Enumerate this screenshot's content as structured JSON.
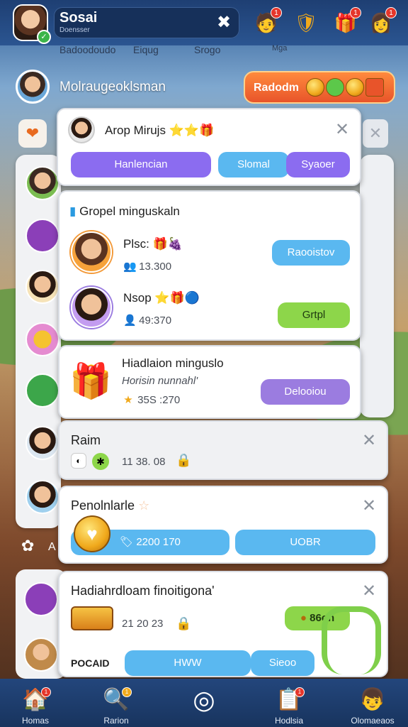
{
  "header": {
    "title": "Sosai",
    "subtitle": "Doensser",
    "close_glyph": "✖",
    "icons": [
      {
        "name": "friend-request-icon",
        "glyph": "🧑",
        "badge": "1"
      },
      {
        "name": "shield-icon",
        "glyph": "🛡",
        "badge": ""
      },
      {
        "name": "gift-icon",
        "glyph": "🎁",
        "badge": "1"
      },
      {
        "name": "profile-notification-icon",
        "glyph": "👩",
        "badge": "1"
      }
    ]
  },
  "subbar": {
    "items": [
      "Badoodoudo",
      "Eiqug",
      "Srogo",
      "Mga"
    ]
  },
  "background": {
    "user_name": "Molraugeoklsman",
    "orange_button_label": "Radodm"
  },
  "cards": {
    "group_invite": {
      "title": "Arop Mirujs",
      "stars": "⭐⭐🎁",
      "buttons": [
        "Hanlencian",
        "Slomal",
        "Syaoer"
      ]
    },
    "group_list": {
      "title": "Gropel minguskaln",
      "entries": [
        {
          "name": "Plsc:",
          "emojis": "🎁🍇",
          "meta": "13.300",
          "action": "Raooistov"
        },
        {
          "name": "Nsop",
          "emojis": "⭐🎁🔵",
          "meta": "49:370",
          "action": "Grtpl"
        }
      ]
    },
    "gift_card": {
      "title": "Hiadlaion minguslo",
      "subtitle": "Horisin nunnahl'",
      "meta": "35S :270",
      "action": "Delooiou"
    },
    "raim": {
      "title": "Raim",
      "meta": "11 38. 08"
    },
    "penplane": {
      "title": "Penolnlarle",
      "btn_left": "2200 170",
      "btn_right": "UOBR"
    },
    "bottom_card": {
      "title": "Hadiahrdloam finoitigona'",
      "meta": "21 20 23",
      "coin_label": "86on",
      "footer_label": "POCAID",
      "btn_left": "HWW",
      "btn_right": "Sieoo"
    }
  },
  "nav": {
    "items": [
      {
        "label": "Homas",
        "glyph": "🏠",
        "badge": "1"
      },
      {
        "label": "Rarion",
        "glyph": "🔍",
        "badge": "1"
      },
      {
        "label": "",
        "glyph": "◎",
        "badge": ""
      },
      {
        "label": "Hodlsia",
        "glyph": "📋",
        "badge": "1"
      },
      {
        "label": "Olomaeaos",
        "glyph": "👦",
        "badge": ""
      }
    ]
  },
  "colors": {
    "purple": "#8b6cf0",
    "light_blue": "#5ab8f0",
    "green": "#8dd64a",
    "orange": "#f06a2a",
    "nav_bg": "#1e3f73"
  }
}
